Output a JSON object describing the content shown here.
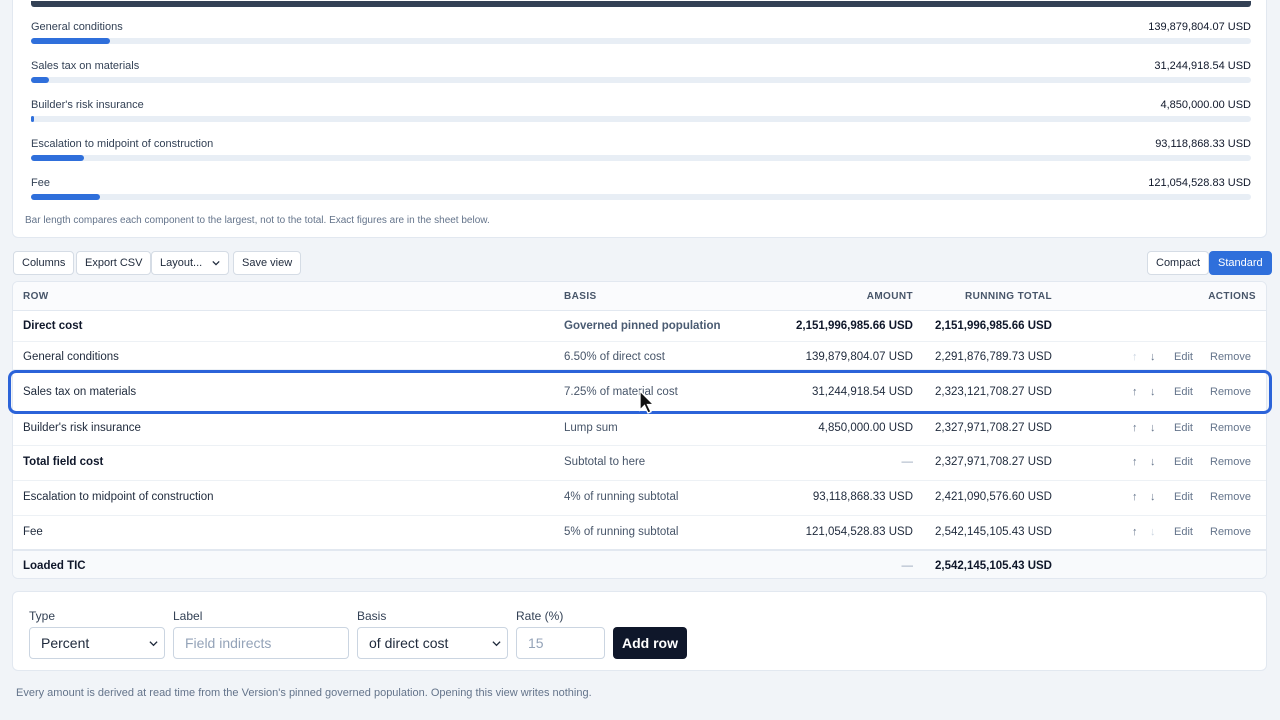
{
  "summary_bars": {
    "items": [
      {
        "label": "General conditions",
        "value": "139,879,804.07 USD",
        "fraction": 0.065
      },
      {
        "label": "Sales tax on materials",
        "value": "31,244,918.54 USD",
        "fraction": 0.0145
      },
      {
        "label": "Builder's risk insurance",
        "value": "4,850,000.00 USD",
        "fraction": 0.0023
      },
      {
        "label": "Escalation to midpoint of construction",
        "value": "93,118,868.33 USD",
        "fraction": 0.0433
      },
      {
        "label": "Fee",
        "value": "121,054,528.83 USD",
        "fraction": 0.0563
      }
    ],
    "note": "Bar length compares each component to the largest, not to the total. Exact figures are in the sheet below."
  },
  "toolbar": {
    "columns": "Columns",
    "export_csv": "Export CSV",
    "layout": "Layout...",
    "save_view": "Save view",
    "compact": "Compact",
    "standard": "Standard"
  },
  "table": {
    "headers": {
      "row": "ROW",
      "basis": "BASIS",
      "amount": "AMOUNT",
      "running_total": "RUNNING TOTAL",
      "actions": "ACTIONS"
    },
    "rows": [
      {
        "row": "Direct cost",
        "basis": "Governed pinned population",
        "amount": "2,151,996,985.66 USD",
        "running_total": "2,151,996,985.66 USD"
      },
      {
        "row": "General conditions",
        "basis": "6.50% of direct cost",
        "amount": "139,879,804.07 USD",
        "running_total": "2,291,876,789.73 USD"
      },
      {
        "row": "Sales tax on materials",
        "basis": "7.25% of material cost",
        "amount": "31,244,918.54 USD",
        "running_total": "2,323,121,708.27 USD"
      },
      {
        "row": "Builder's risk insurance",
        "basis": "Lump sum",
        "amount": "4,850,000.00 USD",
        "running_total": "2,327,971,708.27 USD"
      },
      {
        "row": "Total field cost",
        "basis": "Subtotal to here",
        "amount": "—",
        "running_total": "2,327,971,708.27 USD"
      },
      {
        "row": "Escalation to midpoint of construction",
        "basis": "4% of running subtotal",
        "amount": "93,118,868.33 USD",
        "running_total": "2,421,090,576.60 USD"
      },
      {
        "row": "Fee",
        "basis": "5% of running subtotal",
        "amount": "121,054,528.83 USD",
        "running_total": "2,542,145,105.43 USD"
      }
    ],
    "footer": {
      "row": "Loaded TIC",
      "amount": "—",
      "running_total": "2,542,145,105.43 USD"
    },
    "actions": {
      "up": "↑",
      "down": "↓",
      "edit": "Edit",
      "remove": "Remove"
    }
  },
  "form": {
    "type_label": "Type",
    "type_value": "Percent",
    "label_label": "Label",
    "label_placeholder": "Field indirects",
    "basis_label": "Basis",
    "basis_value": "of direct cost",
    "rate_label": "Rate (%)",
    "rate_placeholder": "15",
    "add_button": "Add row"
  },
  "footnote": "Every amount is derived at read time from the Version's pinned governed population. Opening this view writes nothing.",
  "colors": {
    "accent": "#2f6fdb",
    "highlight": "#2b63d9",
    "dark": "#0f172a"
  }
}
